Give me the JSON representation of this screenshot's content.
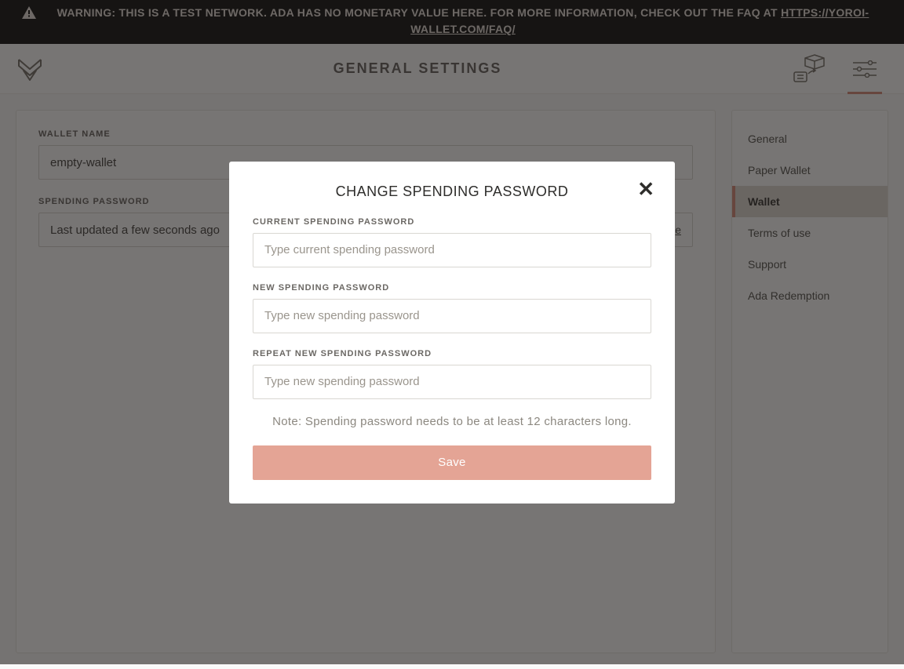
{
  "banner": {
    "prefix": "WARNING: THIS IS A TEST NETWORK. ADA HAS NO MONETARY VALUE HERE. FOR MORE INFORMATION, CHECK OUT THE FAQ AT ",
    "link_text": "HTTPS://YOROI-WALLET.COM/FAQ/"
  },
  "header": {
    "title": "GENERAL SETTINGS"
  },
  "panel": {
    "wallet_name_label": "WALLET NAME",
    "wallet_name_value": "empty-wallet",
    "spending_label": "SPENDING PASSWORD",
    "spending_value": "Last updated a few seconds ago",
    "change_link": "change"
  },
  "sidebar": {
    "items": [
      {
        "label": "General"
      },
      {
        "label": "Paper Wallet"
      },
      {
        "label": "Wallet"
      },
      {
        "label": "Terms of use"
      },
      {
        "label": "Support"
      },
      {
        "label": "Ada Redemption"
      }
    ],
    "active_index": 2
  },
  "modal": {
    "title": "CHANGE SPENDING PASSWORD",
    "current_label": "CURRENT SPENDING PASSWORD",
    "current_placeholder": "Type current spending password",
    "new_label": "NEW SPENDING PASSWORD",
    "new_placeholder": "Type new spending password",
    "repeat_label": "REPEAT NEW SPENDING PASSWORD",
    "repeat_placeholder": "Type new spending password",
    "note": "Note: Spending password needs to be at least 12 characters long.",
    "save_label": "Save"
  }
}
